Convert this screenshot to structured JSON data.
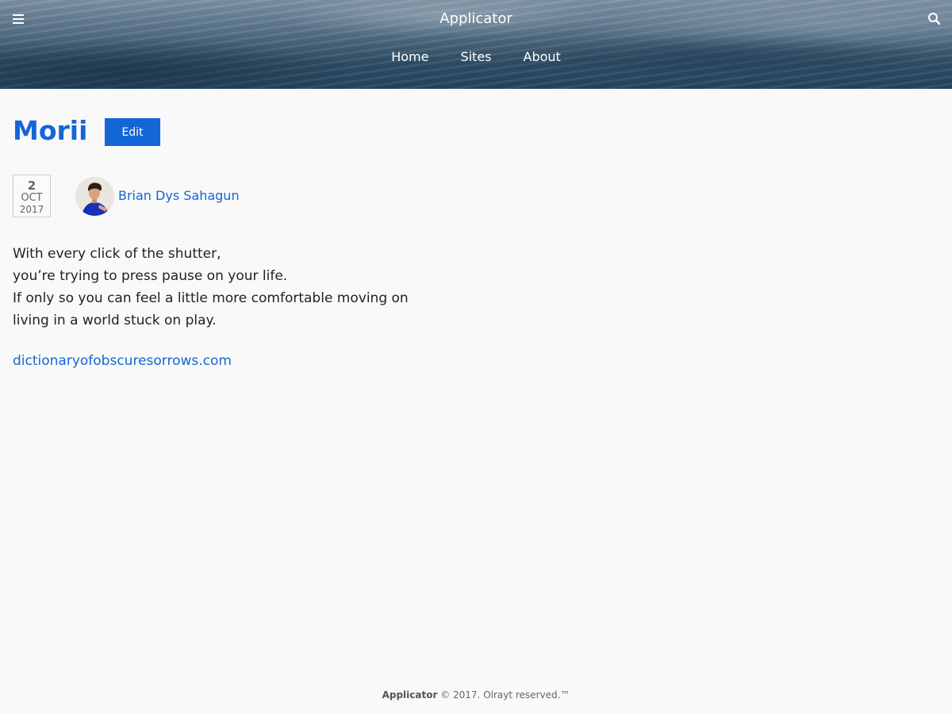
{
  "header": {
    "site_title": "Applicator",
    "nav": [
      {
        "label": "Home"
      },
      {
        "label": "Sites"
      },
      {
        "label": "About"
      }
    ],
    "icons": {
      "menu": "hamburger-menu-icon",
      "search": "search-icon"
    }
  },
  "post": {
    "title": "Morii",
    "edit_label": "Edit",
    "date": {
      "day": "2",
      "month": "OCT",
      "year": "2017"
    },
    "author": "Brian Dys Sahagun",
    "body_lines": [
      "With every click of the shutter,",
      "you’re trying to press pause on your life.",
      "If only so you can feel a little more comfortable moving on",
      "living in a world stuck on play."
    ],
    "source_link": "dictionaryofobscuresorrows.com"
  },
  "footer": {
    "brand": "Applicator",
    "text": " © 2017. Olrayt reserved.™"
  },
  "colors": {
    "accent": "#1565d8",
    "button": "#1266d6",
    "background": "#f9f9fa"
  }
}
